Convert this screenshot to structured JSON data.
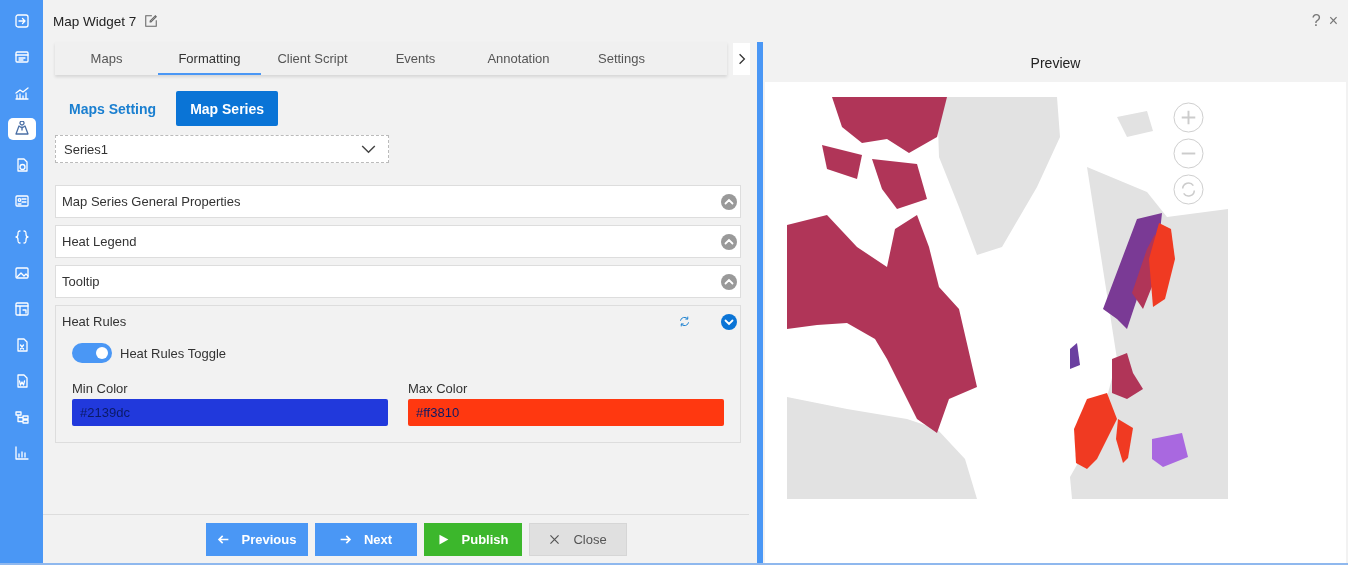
{
  "sidebar": {
    "items": [
      {
        "kind": "login",
        "selected": false
      },
      {
        "kind": "list",
        "selected": false
      },
      {
        "kind": "chart",
        "selected": false
      },
      {
        "kind": "map",
        "selected": true
      },
      {
        "kind": "report",
        "selected": false
      },
      {
        "kind": "card",
        "selected": false
      },
      {
        "kind": "braces",
        "selected": false
      },
      {
        "kind": "image",
        "selected": false
      },
      {
        "kind": "table",
        "selected": false
      },
      {
        "kind": "excel",
        "selected": false
      },
      {
        "kind": "word",
        "selected": false
      },
      {
        "kind": "tree",
        "selected": false
      },
      {
        "kind": "bars",
        "selected": false
      }
    ]
  },
  "window": {
    "title": "Map Widget 7",
    "help": "?",
    "close": "×"
  },
  "tabs": [
    {
      "label": "Maps",
      "selected": false
    },
    {
      "label": "Formatting",
      "selected": true
    },
    {
      "label": "Client Script",
      "selected": false
    },
    {
      "label": "Events",
      "selected": false
    },
    {
      "label": "Annotation",
      "selected": false
    },
    {
      "label": "Settings",
      "selected": false
    }
  ],
  "subtabs": [
    {
      "label": "Maps Setting",
      "selected": false
    },
    {
      "label": "Map Series",
      "selected": true
    }
  ],
  "series_select": {
    "value": "Series1"
  },
  "sections": [
    {
      "title": "Map Series General Properties",
      "expanded": false
    },
    {
      "title": "Heat Legend",
      "expanded": false
    },
    {
      "title": "Tooltip",
      "expanded": false
    },
    {
      "title": "Heat Rules",
      "expanded": true,
      "toggle": {
        "label": "Heat Rules Toggle",
        "on": true
      },
      "fields": [
        {
          "label": "Min Color",
          "value": "#2139dc",
          "color": "#2139dc"
        },
        {
          "label": "Max Color",
          "value": "#ff3810",
          "color": "#ff3810"
        }
      ]
    }
  ],
  "footer_buttons": [
    {
      "label": "Previous",
      "kind": "previous"
    },
    {
      "label": "Next",
      "kind": "next"
    },
    {
      "label": "Publish",
      "kind": "publish"
    },
    {
      "label": "Close",
      "kind": "close"
    }
  ],
  "preview": {
    "title": "Preview"
  }
}
